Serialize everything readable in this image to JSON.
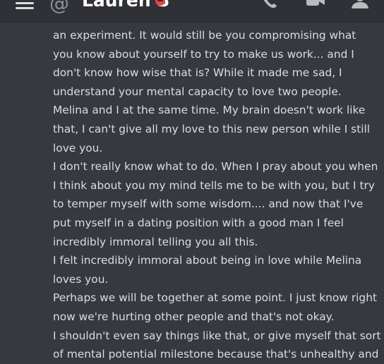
{
  "header": {
    "title": "Lauren S",
    "channel_icon": "at-icon",
    "status": "do-not-disturb",
    "status_color": "#ed4245",
    "icons": [
      "hamburger-menu-icon",
      "call-icon",
      "video-icon",
      "members-icon"
    ]
  },
  "message": {
    "lines": [
      "an experiment. It would still be you compromising what",
      "you know about yourself to try to make us work... and I",
      "don't know how wise that is? While it made me sad, I",
      "understand your mental capacity to love two people.",
      "Melina and I at the same time. My brain doesn't work like",
      "that, I can't give all my love to this new person while I still",
      "love you.",
      "I don't really know what to do. When I pray about you when",
      "I think about you my mind tells me to be with you, but I try",
      "to temper myself with some wisdom.... and now that I've",
      "put myself in a dating position with a good man I feel",
      "incredibly immoral telling you all this.",
      "I felt incredibly immoral about being in love while Melina",
      "loves you.",
      "Perhaps we will be together at some point. I just know right",
      "now we're hurting other people and that's not okay.",
      "I shouldn't even say things like that, or give myself that sort",
      "of mental potential milestone because that's unhealthy and"
    ]
  },
  "colors": {
    "background": "#36393f",
    "header": "#2f3136",
    "text": "#dcddde"
  }
}
